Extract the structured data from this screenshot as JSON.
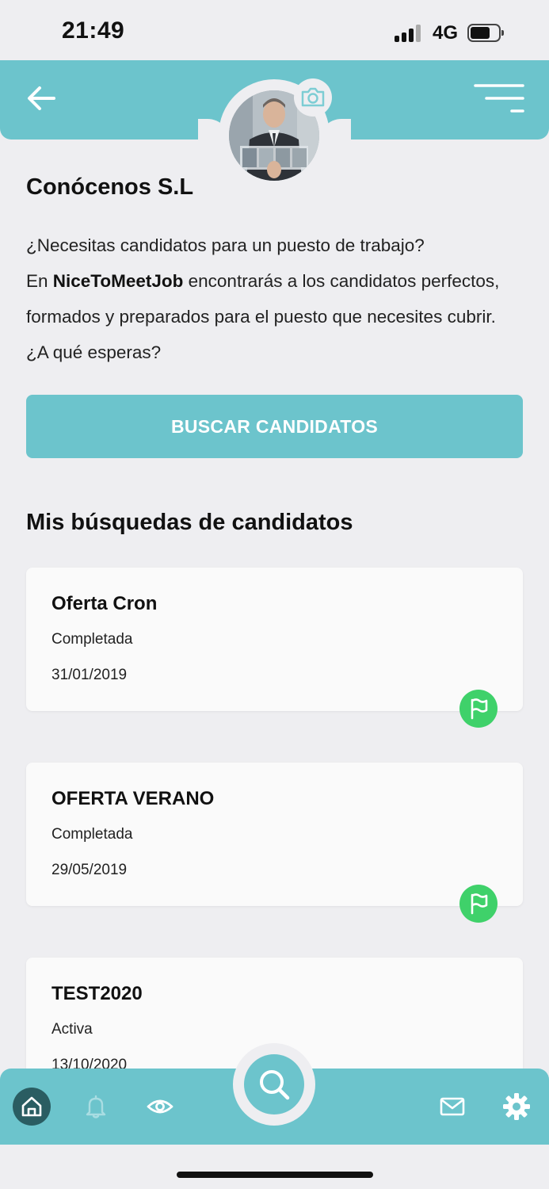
{
  "status_bar": {
    "time": "21:49",
    "network": "4G"
  },
  "header": {
    "company_name": "Conócenos S.L"
  },
  "intro": {
    "line1": "¿Necesitas candidatos para un puesto de trabajo?",
    "line2_prefix": "En ",
    "brand": "NiceToMeetJob",
    "line2_suffix": " encontrarás a los candidatos perfectos,",
    "line3": "formados y preparados para el puesto que necesites cubrir.",
    "line4": "¿A qué esperas?"
  },
  "search_button_label": "BUSCAR CANDIDATOS",
  "section_title": "Mis búsquedas de candidatos",
  "searches": [
    {
      "title": "Oferta Cron",
      "status": "Completada",
      "date": "31/01/2019"
    },
    {
      "title": "OFERTA VERANO",
      "status": "Completada",
      "date": "29/05/2019"
    },
    {
      "title": "TEST2020",
      "status": "Activa",
      "date": "13/10/2020"
    }
  ],
  "colors": {
    "accent": "#6cc4cc",
    "active_nav": "#2a5d62",
    "flag": "#3fd16a",
    "background": "#eeeef1"
  },
  "nav_icons": [
    "home-icon",
    "bell-icon",
    "eye-icon",
    "search-icon",
    "mail-icon",
    "gear-icon"
  ]
}
